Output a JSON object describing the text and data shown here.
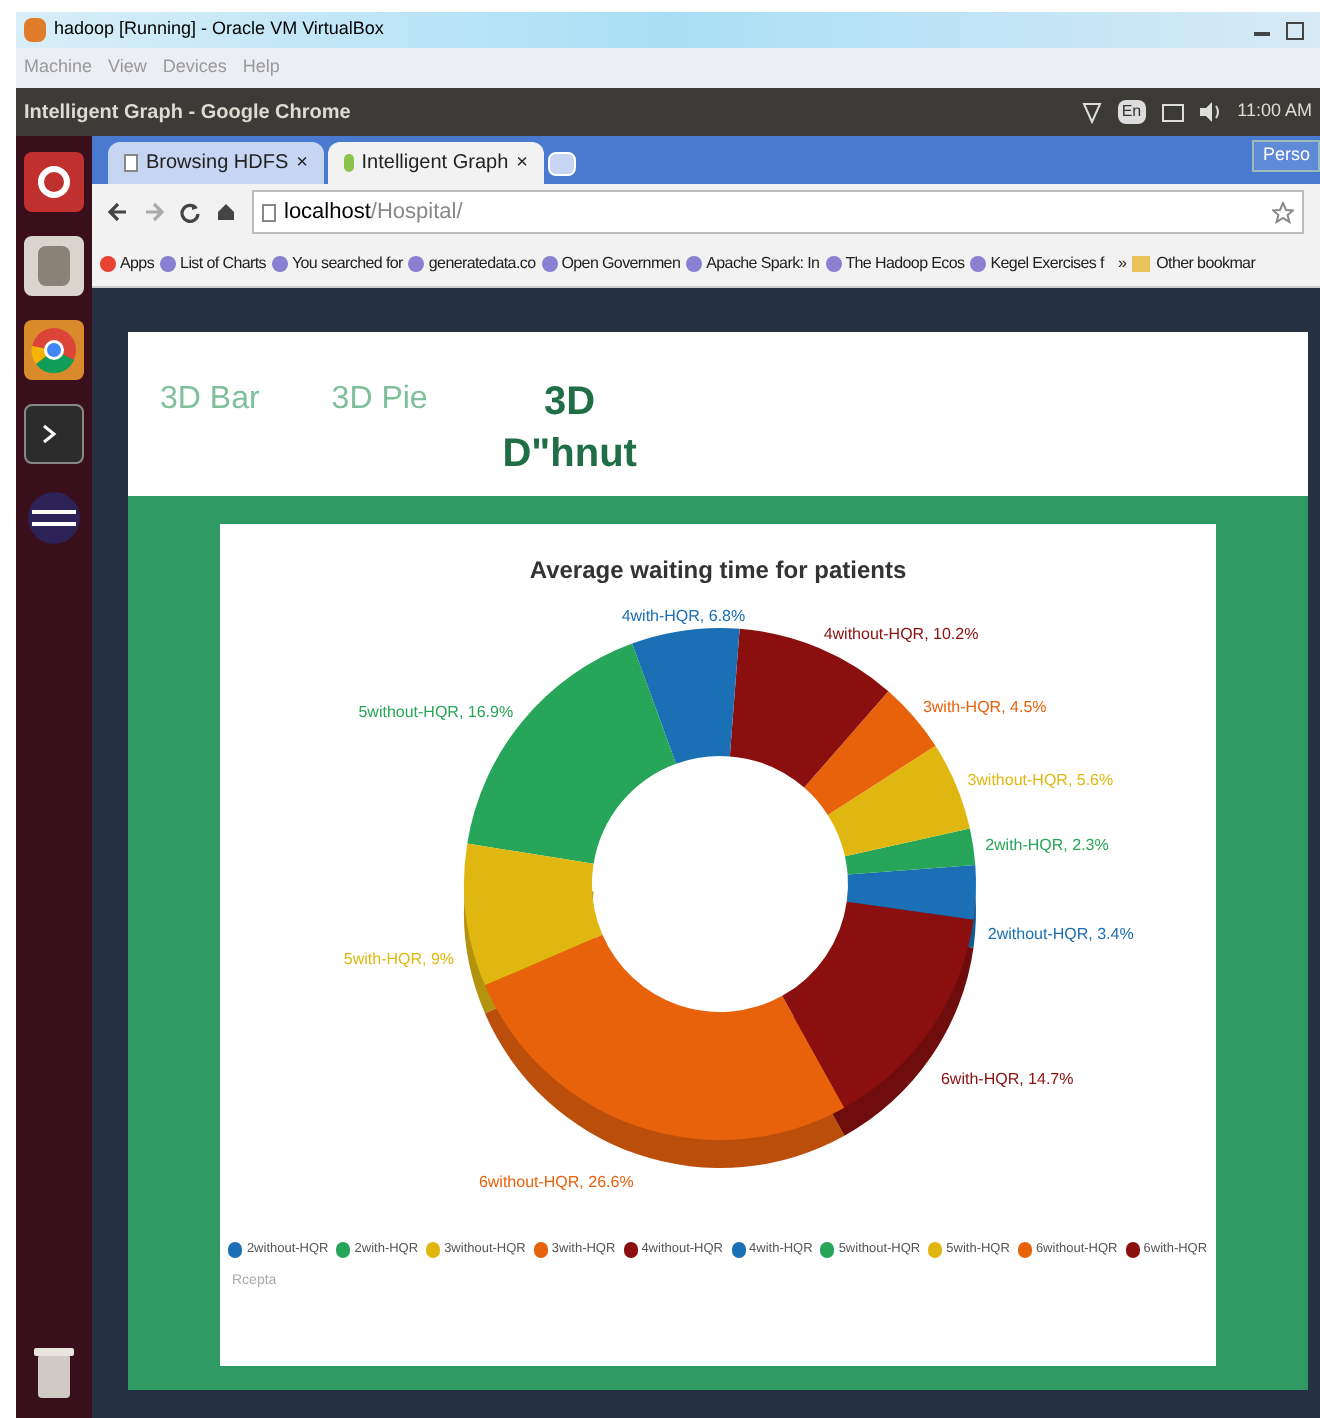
{
  "vm_window": {
    "title": "hadoop [Running] - Oracle VM VirtualBox",
    "menu": [
      "Machine",
      "View",
      "Devices",
      "Help"
    ]
  },
  "top_panel": {
    "title": "Intelligent Graph - Google Chrome",
    "keyboard": "En",
    "time": "11:00 AM"
  },
  "browser": {
    "tabs": [
      {
        "label": "Browsing HDFS",
        "selected": false,
        "close": "×"
      },
      {
        "label": "Intelligent Graph",
        "selected": true,
        "close": "×"
      }
    ],
    "profile": "Perso",
    "address": {
      "host": "localhost",
      "path": "/Hospital/"
    },
    "bookmarks": [
      "Apps",
      "List of Charts",
      "You searched for",
      "generatedata.co",
      "Open Governmen",
      "Apache Spark: In",
      "The Hadoop Ecos",
      "Kegel Exercises f"
    ],
    "more": "»",
    "other_bookmarks": "Other bookmar"
  },
  "page_tabs": [
    {
      "label": "3D Bar",
      "selected": false
    },
    {
      "label": "3D Pie",
      "selected": false
    },
    {
      "label": "3D D\"hnut",
      "selected": true
    }
  ],
  "chart": {
    "chart_data": {
      "type": "donut",
      "title": "Average waiting time for patients",
      "categories": [
        "2without-HQR",
        "2with-HQR",
        "3without-HQR",
        "3with-HQR",
        "4without-HQR",
        "4with-HQR",
        "5without-HQR",
        "5with-HQR",
        "6without-HQR",
        "6with-HQR"
      ],
      "values": [
        3.4,
        2.3,
        5.6,
        4.5,
        10.2,
        6.8,
        16.9,
        9,
        26.6,
        14.7
      ],
      "colors": [
        "#1a6fb5",
        "#27a558",
        "#e0b710",
        "#e8620c",
        "#8b0f0f",
        "#1a6fb5",
        "#27a558",
        "#e0b710",
        "#e8620c",
        "#8b0f0f"
      ],
      "value_labels": [
        "2without-HQR, 3.4%",
        "2with-HQR, 2.3%",
        "3without-HQR, 5.6%",
        "3with-HQR, 4.5%",
        "4without-HQR, 10.2%",
        "4with-HQR, 6.8%",
        "5without-HQR, 16.9%",
        "5with-HQR, 9%",
        "6without-HQR, 26.6%",
        "6with-HQR, 14.7%"
      ]
    },
    "credit": "Rcepta"
  }
}
